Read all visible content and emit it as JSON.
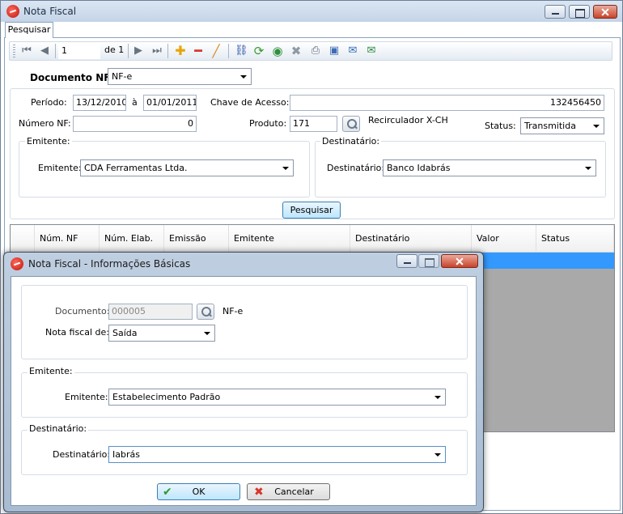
{
  "main_window": {
    "title": "Nota Fiscal",
    "tab": "Pesquisar",
    "navigator": {
      "position": "1",
      "count": "de 1"
    },
    "documento_label": "Documento NF:",
    "documento_value": "NF-e",
    "periodo_label": "Período:",
    "periodo_inicio": "13/12/2010",
    "periodo_sep": "à",
    "periodo_fim": "01/01/2011",
    "chave_label": "Chave de Acesso:",
    "chave_value": "132456450",
    "numero_label": "Número NF:",
    "numero_value": "0",
    "produto_label": "Produto:",
    "produto_code": "171",
    "produto_desc": "Recirculador X-CH",
    "status_label": "Status:",
    "status_value": "Transmitida",
    "emitente_group": "Emitente:",
    "emitente_label": "Emitente:",
    "emitente_value": "CDA Ferramentas Ltda.",
    "destinatario_group": "Destinatário:",
    "destinatario_label": "Destinatário:",
    "destinatario_value": "Banco Idabrás",
    "pesquisar_button": "Pesquisar",
    "grid_columns": [
      "Núm. NF",
      "Núm. Elab.",
      "Emissão",
      "Emitente",
      "Destinatário",
      "Valor",
      "Status"
    ]
  },
  "dialog": {
    "title": "Nota Fiscal - Informações Básicas",
    "documento_label": "Documento:",
    "documento_value": "000005",
    "documento_tipo": "NF-e",
    "nota_fiscal_label": "Nota fiscal de:",
    "nota_fiscal_value": "Saída",
    "emitente_group": "Emitente:",
    "emitente_label": "Emitente:",
    "emitente_value": "Estabelecimento Padrão",
    "destinatario_group": "Destinatário:",
    "destinatario_label": "Destinatário:",
    "destinatario_value": "Iabrás",
    "ok_button": "OK",
    "cancel_button": "Cancelar"
  },
  "icons": [
    "first-record-icon",
    "prev-record-icon",
    "next-record-icon",
    "last-record-icon",
    "add-icon",
    "remove-icon",
    "edit-icon",
    "tree-icon",
    "refresh-icon",
    "globe-icon",
    "delete-icon",
    "print-icon",
    "export-icon",
    "email-icon",
    "send-email-icon"
  ],
  "colors": {
    "selection": "#3399ff",
    "accent_add": "#e8a400",
    "accent_remove": "#d9342b"
  }
}
